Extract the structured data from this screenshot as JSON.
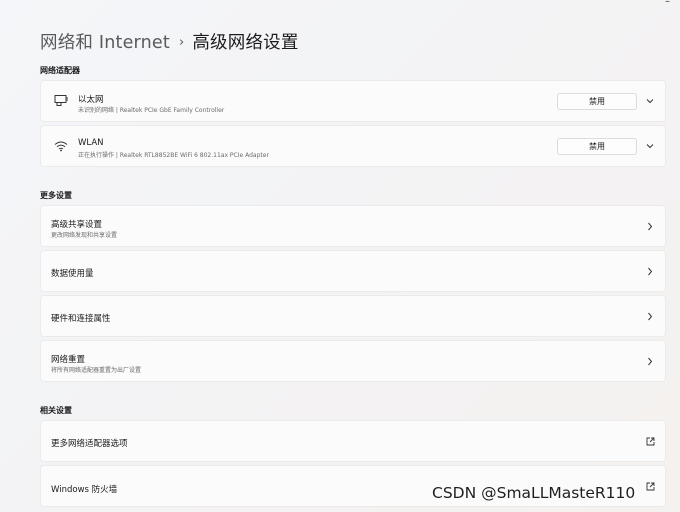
{
  "window": {
    "minimize_glyph": "–"
  },
  "breadcrumb": {
    "parent": "网络和 Internet",
    "separator": "›",
    "current": "高级网络设置"
  },
  "sections": {
    "adapters": "网络适配器",
    "more": "更多设置",
    "related": "相关设置"
  },
  "adapters": [
    {
      "name": "以太网",
      "description": "未识别的网络 | Realtek PCIe GbE Family Controller",
      "button": "禁用",
      "icon": "ethernet-icon"
    },
    {
      "name": "WLAN",
      "description": "正在执行操作 | Realtek RTL8852BE WiFi 6 802.11ax PCIe Adapter",
      "button": "禁用",
      "icon": "wifi-icon"
    }
  ],
  "more_settings": [
    {
      "name": "高级共享设置",
      "description": "更改网络发现和共享设置"
    },
    {
      "name": "数据使用量",
      "description": ""
    },
    {
      "name": "硬件和连接属性",
      "description": ""
    },
    {
      "name": "网络重置",
      "description": "将所有网络适配器重置为出厂设置"
    }
  ],
  "related_settings": [
    {
      "name": "更多网络适配器选项"
    },
    {
      "name": "Windows 防火墙"
    }
  ],
  "watermark": "CSDN @SmaLLMasteR110"
}
